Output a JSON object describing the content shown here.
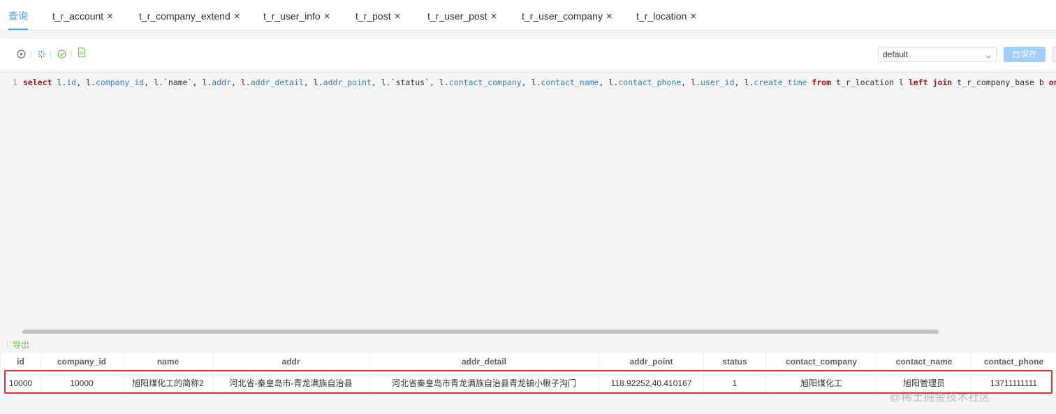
{
  "tabs": [
    {
      "label": "查询",
      "closable": false,
      "active": true
    },
    {
      "label": "t_r_account",
      "closable": true
    },
    {
      "label": "t_r_company_extend",
      "closable": true
    },
    {
      "label": "t_r_user_info",
      "closable": true
    },
    {
      "label": "t_r_post",
      "closable": true
    },
    {
      "label": "t_r_user_post",
      "closable": true
    },
    {
      "label": "t_r_user_company",
      "closable": true
    },
    {
      "label": "t_r_location",
      "closable": true
    }
  ],
  "close_glyph": "×",
  "toolbar": {
    "icons": [
      "run-icon",
      "format-icon",
      "check-icon",
      "document-icon"
    ],
    "datasource_value": "default",
    "save_label": "保存"
  },
  "editor": {
    "line_number": "1",
    "sql": "select l.id, l.company_id, l.`name`, l.addr, l.addr_detail, l.addr_point, l.`status`, l.contact_company, l.contact_name, l.contact_phone, l.user_id, l.create_time from t_r_location l left join t_r_company_base b on l.co"
  },
  "export_label": "导出",
  "table": {
    "columns": [
      "id",
      "company_id",
      "name",
      "addr",
      "addr_detail",
      "addr_point",
      "status",
      "contact_company",
      "contact_name",
      "contact_phone"
    ],
    "rows": [
      [
        "10000",
        "10000",
        "旭阳煤化工的简称2",
        "河北省-秦皇岛市-青龙满族自治县",
        "河北省秦皇岛市青龙满族自治县青龙镇小楸子沟门",
        "118.92252,40.410167",
        "1",
        "旭阳煤化工",
        "旭阳管理员",
        "13711111111"
      ]
    ]
  },
  "watermark": "@稀土掘金技术社区",
  "colors": {
    "accent": "#409eff",
    "highlight": "#e52e2e",
    "export": "#67c23a"
  }
}
